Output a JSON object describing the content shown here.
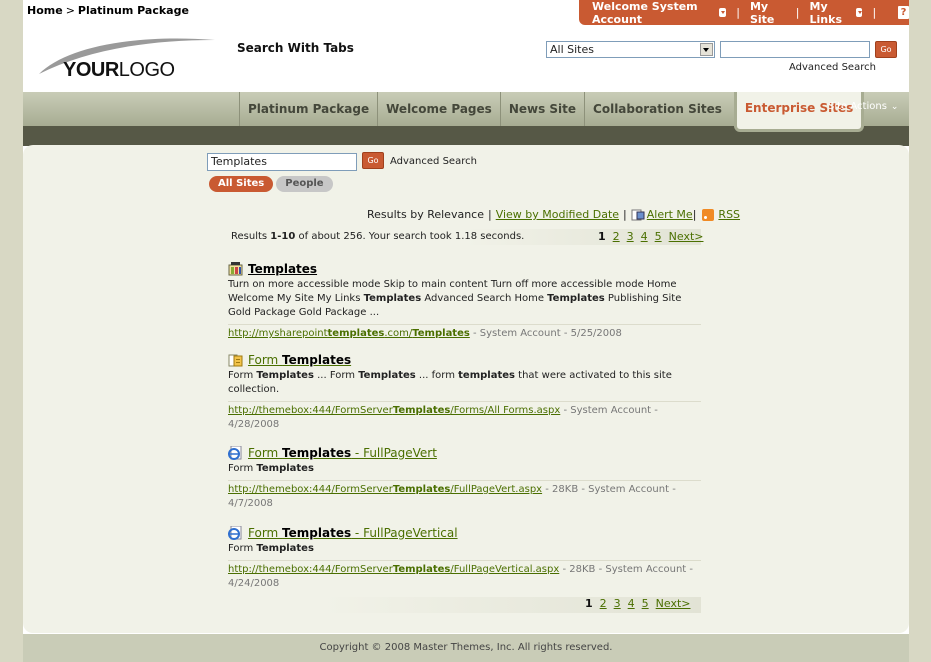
{
  "breadcrumb": {
    "home": "Home",
    "sep": ">",
    "current": "Platinum Package"
  },
  "welcome": {
    "account": "Welcome System Account",
    "my_site": "My Site",
    "my_links": "My Links",
    "sep": "|",
    "help": "?"
  },
  "logo": {
    "bold": "YOUR",
    "light": "LOGO"
  },
  "page_title": "Search With Tabs",
  "header_search": {
    "scope": "All Sites",
    "query": "",
    "go": "Go",
    "advanced": "Advanced Search"
  },
  "nav": {
    "tabs": [
      {
        "label": "Platinum Package"
      },
      {
        "label": "Welcome Pages"
      },
      {
        "label": "News Site"
      },
      {
        "label": "Collaboration Sites"
      },
      {
        "label": "Enterprise Sites"
      }
    ],
    "site_actions": "Site Actions"
  },
  "search": {
    "query": "Templates",
    "go": "Go",
    "advanced": "Advanced Search",
    "tabs": [
      {
        "label": "All Sites"
      },
      {
        "label": "People"
      }
    ]
  },
  "sort": {
    "by_relevance": "Results by Relevance",
    "by_modified": "View by Modified Date",
    "alert": "Alert Me",
    "rss": "RSS",
    "sep": "|"
  },
  "results_summary": {
    "prefix": "Results ",
    "range": "1-10",
    "rest": " of about 256. Your search took 1.18 seconds."
  },
  "pager": {
    "pages": [
      "1",
      "2",
      "3",
      "4",
      "5"
    ],
    "next": "Next>"
  },
  "results": [
    {
      "icon": "site-icon",
      "title": "Templates",
      "desc_parts": [
        "Turn on more accessible mode Skip to main content Turn off more accessible mode Home Welcome My Site My Links ",
        "Templates",
        " Advanced Search Home ",
        "Templates",
        " Publishing Site Gold Package Gold Package ..."
      ],
      "url_parts": [
        "http://mysharepoint",
        "templates",
        ".com/",
        "Templates"
      ],
      "meta": " - System Account - 5/25/2008"
    },
    {
      "icon": "form-library-icon",
      "title_parts": [
        "Form ",
        "Templates"
      ],
      "desc_parts": [
        "Form ",
        "Templates",
        " ... Form ",
        "Templates",
        " ... form ",
        "templates",
        " that were activated to this site collection."
      ],
      "url_parts": [
        "http://themebox:444/FormServer",
        "Templates",
        "/Forms/All Forms.aspx"
      ],
      "meta": " - System Account - 4/28/2008"
    },
    {
      "icon": "ie-page-icon",
      "title_parts": [
        "Form ",
        "Templates",
        " - FullPageVert"
      ],
      "desc_parts": [
        "Form ",
        "Templates"
      ],
      "url_parts": [
        "http://themebox:444/FormServer",
        "Templates",
        "/FullPageVert.aspx"
      ],
      "meta": " - 28KB - System Account - 4/7/2008"
    },
    {
      "icon": "ie-page-icon",
      "title_parts": [
        "Form ",
        "Templates",
        " - FullPageVertical"
      ],
      "desc_parts": [
        "Form ",
        "Templates"
      ],
      "url_parts": [
        "http://themebox:444/FormServer",
        "Templates",
        "/FullPageVertical.aspx"
      ],
      "meta": " - 28KB - System Account - 4/24/2008"
    }
  ],
  "footer": "Copyright © 2008 Master Themes, Inc. All rights reserved.",
  "colors": {
    "accent": "#c95a32",
    "link": "#4a6f00",
    "nav_band": "#c9ccb7",
    "dark_band": "#565846",
    "content_bg": "#f1f2e8"
  }
}
